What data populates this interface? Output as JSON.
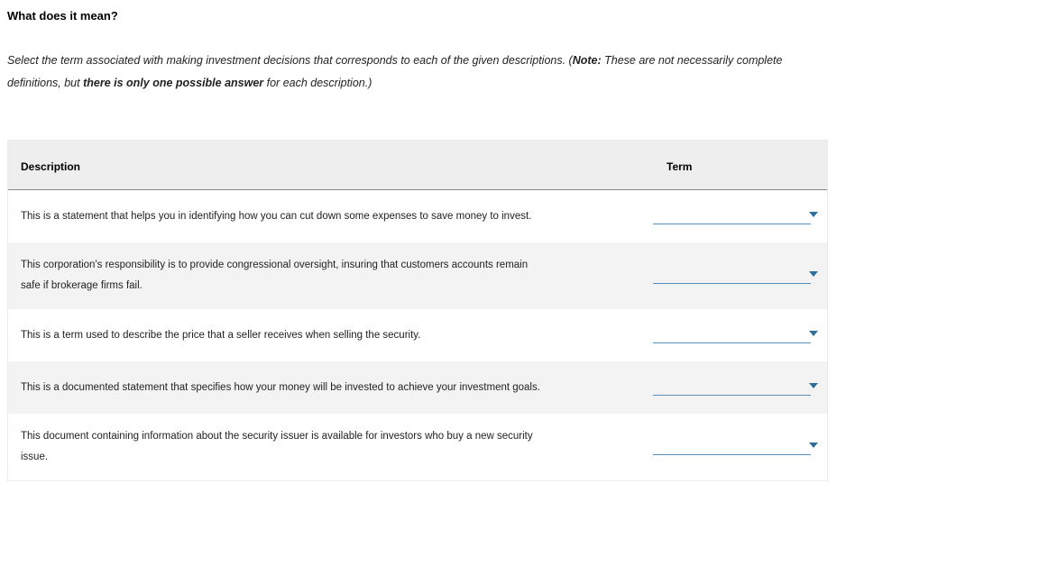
{
  "title": "What does it mean?",
  "instructions": {
    "pre": "Select the term associated with making investment decisions that corresponds to each of the given descriptions. (",
    "note_label": "Note:",
    "mid": " These are not necessarily complete definitions, but ",
    "emph": "there is only one possible answer",
    "post": " for each description.)"
  },
  "headers": {
    "description": "Description",
    "term": "Term"
  },
  "rows": [
    {
      "desc": "This is a statement that helps you in identifying how you can cut down some expenses to save money to invest."
    },
    {
      "desc": "This corporation's responsibility is to provide congressional oversight, insuring that customers accounts remain safe if brokerage firms fail."
    },
    {
      "desc": "This is a term used to describe the price that a seller receives when selling the security."
    },
    {
      "desc": "This is a documented statement that specifies how your money will be invested to achieve your investment goals."
    },
    {
      "desc": "This document containing information about the security issuer is available for investors who buy a new security issue."
    }
  ]
}
